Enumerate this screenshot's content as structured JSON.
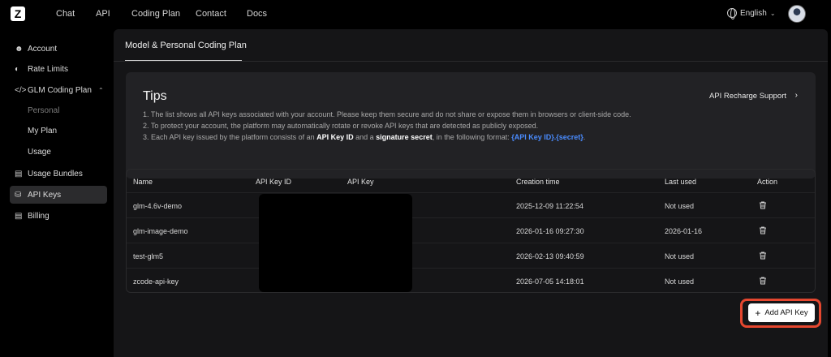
{
  "nav": {
    "logo_letter": "Z",
    "links": [
      "Chat",
      "API",
      "Coding Plan",
      "Contact",
      "Docs"
    ],
    "language": "English"
  },
  "sidebar": {
    "items": [
      {
        "label": "Account",
        "icon": "user-icon"
      },
      {
        "label": "Rate Limits",
        "icon": "gauge-icon"
      },
      {
        "label": "GLM Coding Plan",
        "icon": "code-icon"
      },
      {
        "label": "Usage Bundles",
        "icon": "calendar-icon"
      },
      {
        "label": "API Keys",
        "icon": "key-icon"
      },
      {
        "label": "Billing",
        "icon": "billing-icon"
      }
    ],
    "sub_items": [
      "Personal",
      "My Plan",
      "Usage"
    ]
  },
  "main": {
    "tab_label": "Model & Personal Coding Plan",
    "tips": {
      "title": "Tips",
      "link_label": "API Recharge Support",
      "line1": "1. The list shows all API keys associated with your account. Please keep them secure and do not share or expose them in browsers or client-side code.",
      "line2": "2. To protect your account, the platform may automatically rotate or revoke API keys that are detected as publicly exposed.",
      "line3_prefix": "3. Each API key issued by the platform consists of an ",
      "line3_bold1": "API Key ID",
      "line3_mid": " and a ",
      "line3_bold2": "signature secret",
      "line3_after": ", in the following format: ",
      "line3_code": "{API Key ID}.{secret}",
      "line3_end": "."
    },
    "table": {
      "headers": [
        "Name",
        "API Key ID",
        "API Key",
        "Creation time",
        "Last used",
        "Action"
      ],
      "rows": [
        {
          "name": "glm-4.6v-demo",
          "created": "2025-12-09 11:22:54",
          "last_used": "Not used"
        },
        {
          "name": "glm-image-demo",
          "created": "2026-01-16 09:27:30",
          "last_used": "2026-01-16"
        },
        {
          "name": "test-glm5",
          "created": "2026-02-13 09:40:59",
          "last_used": "Not used"
        },
        {
          "name": "zcode-api-key",
          "created": "2026-07-05 14:18:01",
          "last_used": "Not used"
        }
      ]
    },
    "add_button_label": "Add API Key"
  },
  "colors": {
    "highlight": "#e5472f",
    "code_blue": "#4a8cff",
    "panel": "#151517"
  }
}
